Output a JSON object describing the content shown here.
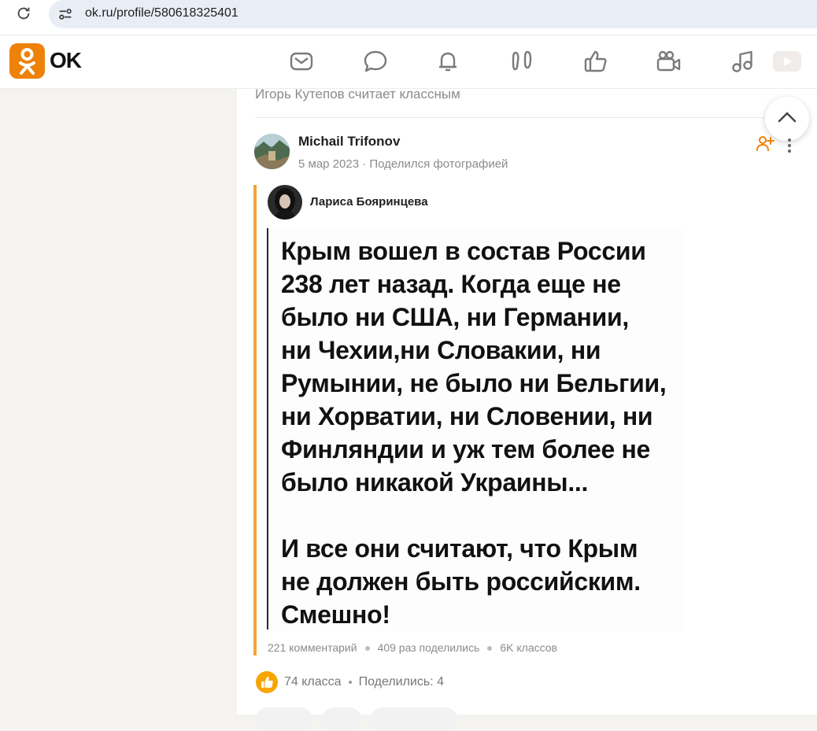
{
  "browser": {
    "url": "ok.ru/profile/580618325401"
  },
  "header": {
    "logo_text": "OK",
    "nav_icons": [
      "mail-icon",
      "chat-icon",
      "bell-icon",
      "guests-footprints-icon",
      "like-thumb-icon",
      "video-camera-icon",
      "music-note-icon",
      "video-play-icon"
    ],
    "accent_color": "#ee8208"
  },
  "feed": {
    "liked_by_text": "Игорь Кутепов считает классным",
    "post": {
      "author": "Michail Trifonov",
      "meta": "5 мар 2023 · Поделился фотографией",
      "repost": {
        "author": "Лариса Бояринцева",
        "image_text": "Крым вошел в состав России\n238 лет назад. Когда еще не\nбыло ни США, ни Германии,\nни Чехии,ни Словакии, ни\nРумынии, не было ни Бельгии,\nни Хорватии, ни Словении, ни\nФинляндии и уж тем более не\nбыло никакой Украины...\n\nИ все они считают, что Крым\nне должен быть российским.\nСмешно!",
        "stats": {
          "comments": "221 комментарий",
          "shares": "409 раз поделились",
          "likes": "6K классов"
        }
      },
      "footer": {
        "likes": "74 класса",
        "shares": "Поделились: 4"
      }
    }
  }
}
